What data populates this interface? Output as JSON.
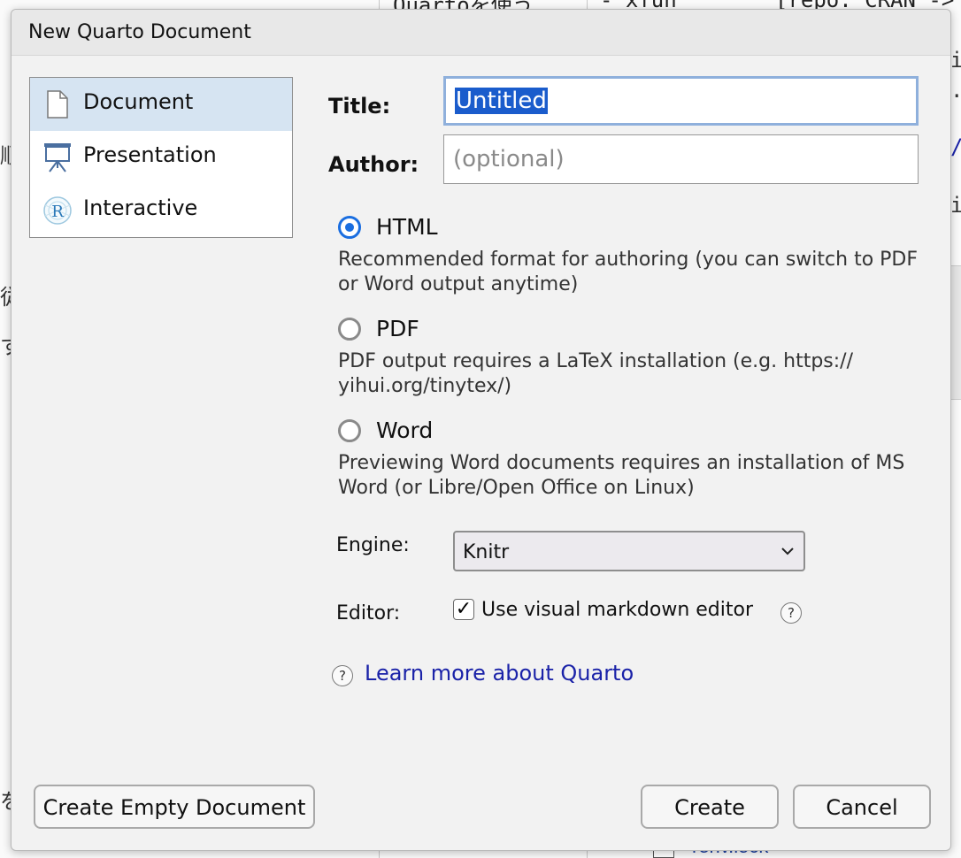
{
  "background": {
    "code_line_1": "Quartoを使う",
    "code_line_2": "- xfun",
    "code_line_3": "[repo: CRAN ->",
    "file_name": "renv.lock",
    "left_fragments": [
      "順",
      "従",
      "す",
      "を"
    ],
    "right_fragments": [
      "i",
      ".",
      "/",
      "i"
    ]
  },
  "dialog": {
    "title": "New Quarto Document",
    "types": [
      {
        "label": "Document",
        "icon": "document-icon",
        "selected": true
      },
      {
        "label": "Presentation",
        "icon": "presentation-icon",
        "selected": false
      },
      {
        "label": "Interactive",
        "icon": "r-logo-icon",
        "selected": false
      }
    ],
    "title_label": "Title:",
    "title_value": "Untitled",
    "author_label": "Author:",
    "author_placeholder": "(optional)",
    "formats": [
      {
        "label": "HTML",
        "checked": true,
        "description": "Recommended format for authoring (you can switch to PDF or Word output anytime)"
      },
      {
        "label": "PDF",
        "checked": false,
        "description": "PDF output requires a LaTeX installation (e.g. https:// yihui.org/tinytex/)"
      },
      {
        "label": "Word",
        "checked": false,
        "description": "Previewing Word documents requires an installation of MS Word (or Libre/Open Office on Linux)"
      }
    ],
    "engine_label": "Engine:",
    "engine_value": "Knitr",
    "editor_label": "Editor:",
    "visual_editor_label": "Use visual markdown editor",
    "visual_editor_checked": true,
    "help_glyph": "?",
    "learn_more": "Learn more about Quarto",
    "buttons": {
      "create_empty": "Create Empty Document",
      "create": "Create",
      "cancel": "Cancel"
    }
  },
  "colors": {
    "accent": "#1a6ee0",
    "selection": "#1a5ccc",
    "link": "#1a22a8",
    "selected_row": "#d6e4f2"
  }
}
